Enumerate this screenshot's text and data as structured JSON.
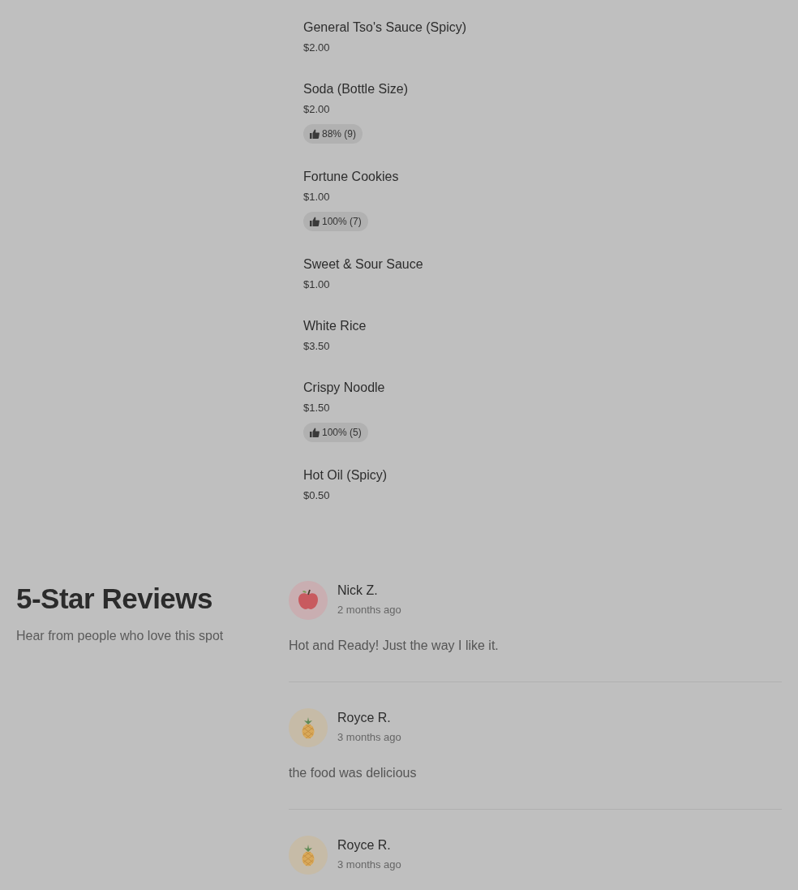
{
  "menu_items": [
    {
      "name": "General Tso's Sauce (Spicy)",
      "price": "$2.00"
    },
    {
      "name": "Soda (Bottle Size)",
      "price": "$2.00",
      "rating": "88% (9)"
    },
    {
      "name": "Fortune Cookies",
      "price": "$1.00",
      "rating": "100% (7)"
    },
    {
      "name": "Sweet & Sour Sauce",
      "price": "$1.00"
    },
    {
      "name": "White Rice",
      "price": "$3.50"
    },
    {
      "name": "Crispy Noodle",
      "price": "$1.50",
      "rating": "100% (5)"
    },
    {
      "name": "Hot Oil (Spicy)",
      "price": "$0.50"
    }
  ],
  "reviews_section": {
    "title": "5-Star Reviews",
    "subtitle": "Hear from people who love this spot"
  },
  "reviews": [
    {
      "avatar": {
        "kind": "apple"
      },
      "name": "Nick Z.",
      "time": "2 months ago",
      "text": "Hot and Ready! Just the way I like it."
    },
    {
      "avatar": {
        "kind": "pineapple"
      },
      "name": "Royce R.",
      "time": "3 months ago",
      "text": "the food was delicious"
    },
    {
      "avatar": {
        "kind": "pineapple"
      },
      "name": "Royce R.",
      "time": "3 months ago"
    }
  ]
}
